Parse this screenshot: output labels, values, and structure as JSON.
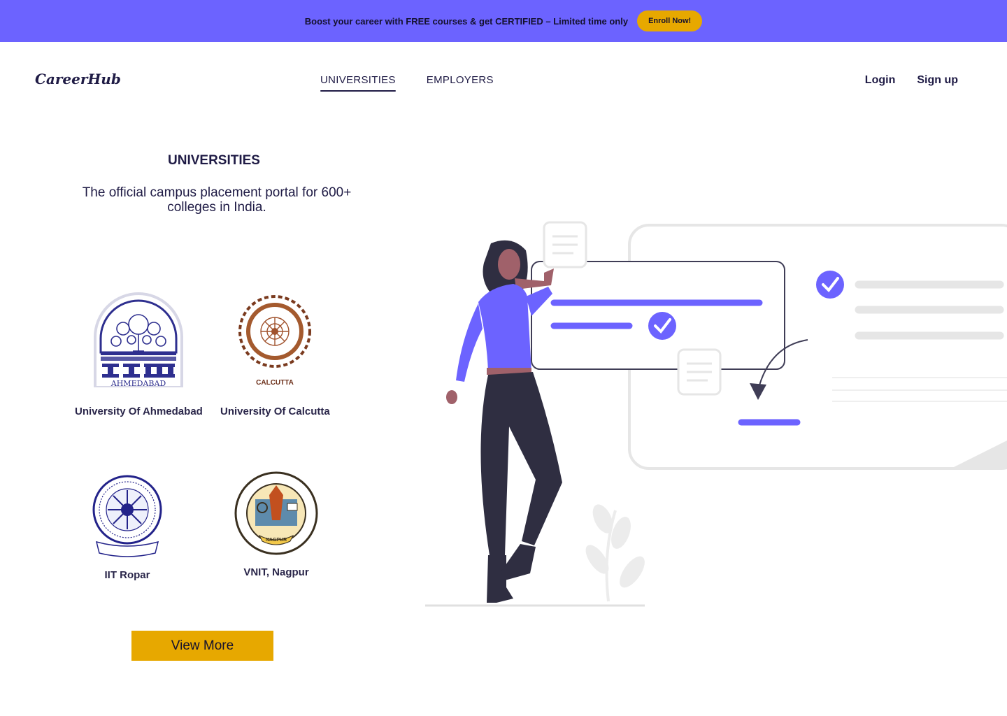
{
  "promo": {
    "text": "Boost your career with FREE courses & get CERTIFIED – Limited time only",
    "button_label": "Enroll Now!"
  },
  "brand": "CareerHub",
  "nav": [
    {
      "label": "UNIVERSITIES",
      "active": true
    },
    {
      "label": "EMPLOYERS",
      "active": false
    }
  ],
  "auth": {
    "login": "Login",
    "signup": "Sign up"
  },
  "section": {
    "title": "UNIVERSITIES",
    "subtitle": "The official campus placement portal for 600+ colleges in India."
  },
  "universities": [
    {
      "name": "University Of Ahmedabad",
      "logo": "iim-ahmedabad-logo",
      "logo_text": "AHMEDABAD"
    },
    {
      "name": "University Of Calcutta",
      "logo": "iim-calcutta-logo",
      "logo_text": "INDIAN INSTITUTE OF MANAGEMENT · CALCUTTA"
    },
    {
      "name": "IIT Ropar",
      "logo": "iit-ropar-logo"
    },
    {
      "name": "VNIT, Nagpur",
      "logo": "vnit-nagpur-logo",
      "logo_text": "VISVESVARAYA NATIONAL INSTITUTE OF TECHNOLOGY · NAGPUR"
    }
  ],
  "view_more_label": "View More",
  "colors": {
    "accent": "#6c63ff",
    "button": "#e7a800",
    "text": "#1f1b45"
  }
}
